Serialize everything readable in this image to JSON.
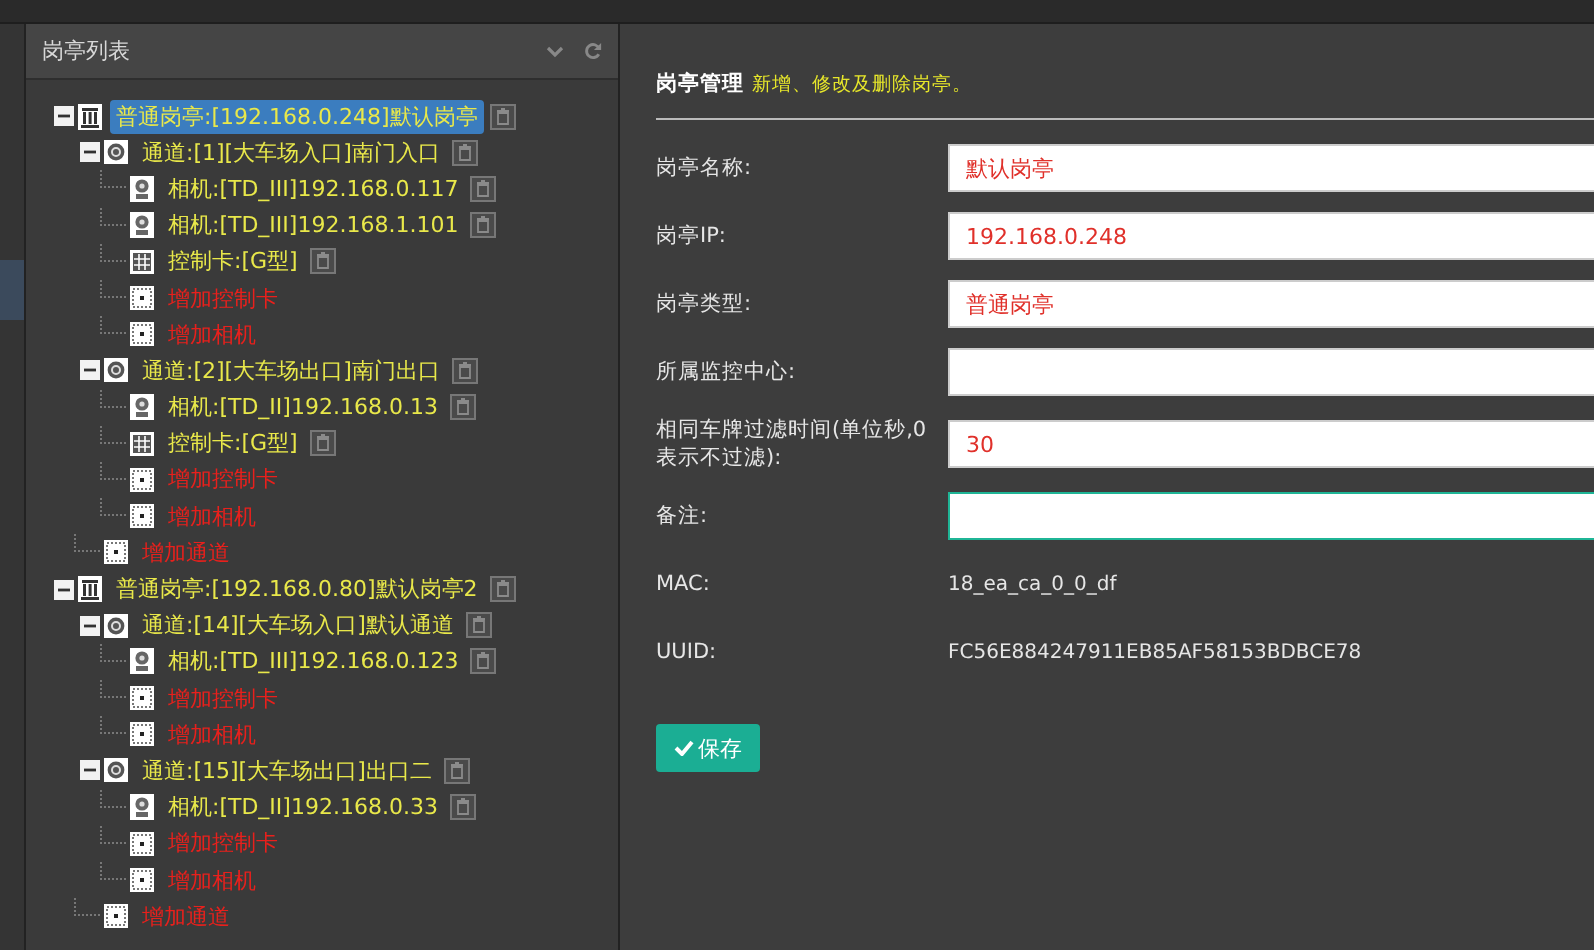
{
  "panel": {
    "title": "岗亭列表"
  },
  "tree": [
    {
      "kind": "booth",
      "label": "普通岗亭:[192.168.0.248]默认岗亭",
      "selected": true,
      "expanded": true,
      "children": [
        {
          "kind": "channel",
          "label": "通道:[1][大车场入口]南门入口",
          "selected": false,
          "expanded": true,
          "children": [
            {
              "kind": "camera",
              "label": "相机:[TD_III]192.168.0.117",
              "selected": false
            },
            {
              "kind": "camera",
              "label": "相机:[TD_III]192.168.1.101",
              "selected": false
            },
            {
              "kind": "card",
              "label": "控制卡:[G型]",
              "selected": false
            },
            {
              "kind": "add",
              "label": "增加控制卡",
              "selected": false
            },
            {
              "kind": "add",
              "label": "增加相机",
              "selected": false
            }
          ]
        },
        {
          "kind": "channel",
          "label": "通道:[2][大车场出口]南门出口",
          "selected": false,
          "expanded": true,
          "children": [
            {
              "kind": "camera",
              "label": "相机:[TD_II]192.168.0.13",
              "selected": false
            },
            {
              "kind": "card",
              "label": "控制卡:[G型]",
              "selected": false
            },
            {
              "kind": "add",
              "label": "增加控制卡",
              "selected": false
            },
            {
              "kind": "add",
              "label": "增加相机",
              "selected": false
            }
          ]
        },
        {
          "kind": "add",
          "label": "增加通道",
          "selected": false
        }
      ]
    },
    {
      "kind": "booth",
      "label": "普通岗亭:[192.168.0.80]默认岗亭2",
      "selected": false,
      "expanded": true,
      "children": [
        {
          "kind": "channel",
          "label": "通道:[14][大车场入口]默认通道",
          "selected": false,
          "expanded": true,
          "children": [
            {
              "kind": "camera",
              "label": "相机:[TD_III]192.168.0.123",
              "selected": false
            },
            {
              "kind": "add",
              "label": "增加控制卡",
              "selected": false
            },
            {
              "kind": "add",
              "label": "增加相机",
              "selected": false
            }
          ]
        },
        {
          "kind": "channel",
          "label": "通道:[15][大车场出口]出口二",
          "selected": false,
          "expanded": true,
          "children": [
            {
              "kind": "camera",
              "label": "相机:[TD_II]192.168.0.33",
              "selected": false
            },
            {
              "kind": "add",
              "label": "增加控制卡",
              "selected": false
            },
            {
              "kind": "add",
              "label": "增加相机",
              "selected": false
            }
          ]
        },
        {
          "kind": "add",
          "label": "增加通道",
          "selected": false
        }
      ]
    }
  ],
  "form": {
    "title": "岗亭管理",
    "subtitle": "新增、修改及删除岗亭。",
    "fields": [
      {
        "kind": "input",
        "label": "岗亭名称:",
        "value": "默认岗亭",
        "focused": false
      },
      {
        "kind": "input",
        "label": "岗亭IP:",
        "value": "192.168.0.248",
        "focused": false
      },
      {
        "kind": "input",
        "label": "岗亭类型:",
        "value": "普通岗亭",
        "focused": false
      },
      {
        "kind": "input",
        "label": "所属监控中心:",
        "focused": false
      },
      {
        "kind": "input",
        "label": "相同车牌过滤时间(单位秒,0表示不过滤):",
        "value": "30",
        "focused": false
      },
      {
        "kind": "input",
        "label": "备注:",
        "focused": true
      },
      {
        "kind": "text",
        "label": "MAC:",
        "value": "18_ea_ca_0_0_df"
      },
      {
        "kind": "text",
        "label": "UUID:",
        "value": "FC56E884247911EB85AF58153BDBCE78"
      }
    ],
    "save_button": {
      "label": "保存"
    }
  }
}
